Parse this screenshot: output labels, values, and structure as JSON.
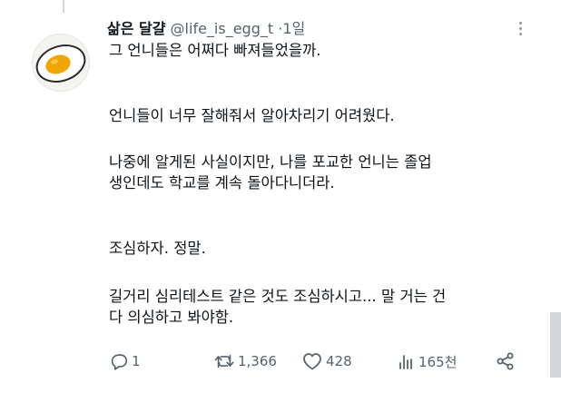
{
  "tweet": {
    "author_name": "삶은 달걀",
    "handle": "@life_is_egg_t",
    "separator": "·",
    "time": "1일",
    "paragraphs": [
      [
        "그 언니들은 어쩌다 빠져들었을까."
      ],
      [
        "언니들이 너무 잘해줘서 알아차리기 어려웠다."
      ],
      [
        "나중에 알게된 사실이지만, 나를 포교한 언니는 졸업",
        "생인데도 학교를 계속 돌아다니더라."
      ],
      [
        "조심하자. 정말."
      ],
      [
        "길거리 심리테스트 같은 것도 조심하시고... 말 거는 건",
        "다 의심하고 봐야함."
      ]
    ]
  },
  "actions": {
    "reply_count": "1",
    "retweet_count": "1,366",
    "like_count": "428",
    "view_count": "165천"
  },
  "icons": {
    "avatar": "boiled-egg-avatar",
    "more": "more-icon",
    "reply": "reply-icon",
    "retweet": "retweet-icon",
    "like": "heart-icon",
    "views": "views-icon",
    "share": "share-icon"
  },
  "colors": {
    "text": "#0f1419",
    "muted": "#536471",
    "thread_line": "#cfd9de",
    "egg_yolk": "#f0a500"
  }
}
